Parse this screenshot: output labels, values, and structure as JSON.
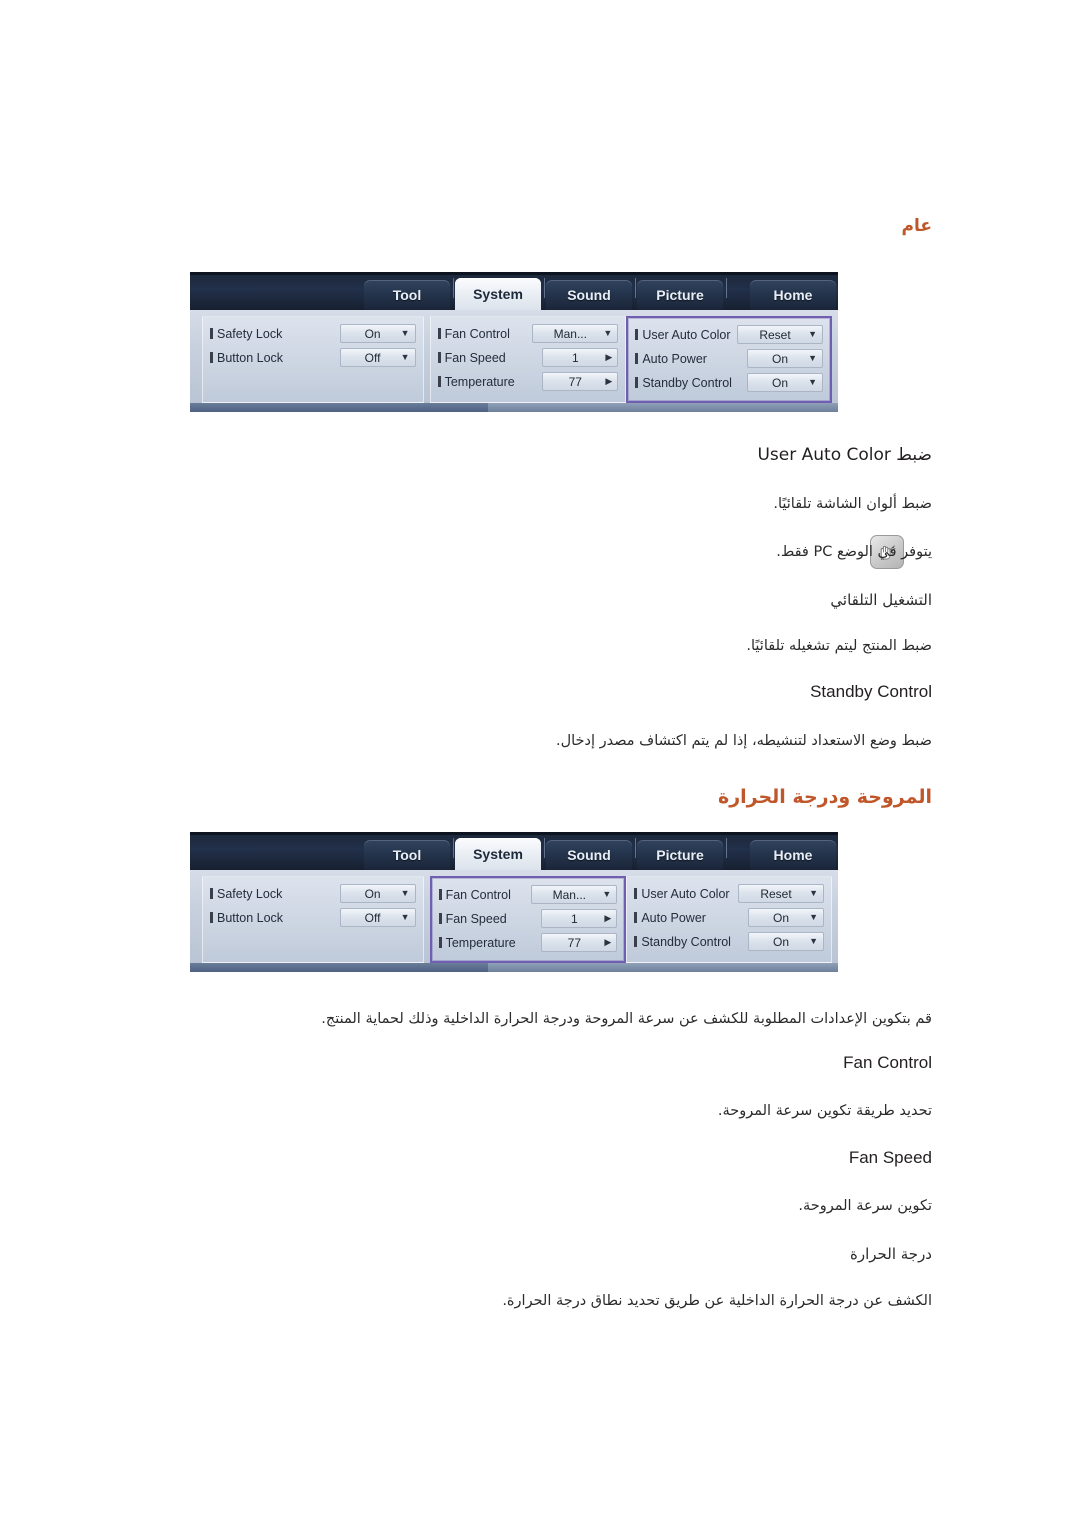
{
  "sections": {
    "general": {
      "heading": "عام",
      "subhead_user_auto_color": "ضبط User Auto Color",
      "desc_user_auto_color": "ضبط ألوان الشاشة تلقائيًا.",
      "note": "يتوفر في الوضع PC فقط.",
      "subhead_auto_power": "التشغيل التلقائي",
      "desc_auto_power": "ضبط المنتج ليتم تشغيله تلقائيًا.",
      "subhead_standby": "Standby Control",
      "desc_standby": "ضبط وضع الاستعداد لتنشيطه، إذا لم يتم اكتشاف مصدر إدخال.",
      "note_icon": "note-hand-icon"
    },
    "fan": {
      "heading": "المروحة ودرجة الحرارة",
      "intro": "قم بتكوين الإعدادات المطلوبة للكشف عن سرعة المروحة ودرجة الحرارة الداخلية وذلك لحماية المنتج.",
      "subhead_fan_control": "Fan Control",
      "desc_fan_control": "تحديد طريقة تكوين سرعة المروحة.",
      "subhead_fan_speed": "Fan Speed",
      "desc_fan_speed": "تكوين سرعة المروحة.",
      "subhead_temperature": "درجة الحرارة",
      "desc_temperature": "الكشف عن درجة الحرارة الداخلية عن طريق تحديد نطاق درجة الحرارة."
    }
  },
  "colors": {
    "heading_accent": "#c0572a",
    "highlight_border": "#6f5fb0",
    "osd_tabbar": "#1b2638",
    "body_text": "#231f20"
  },
  "osd": {
    "tabs": [
      {
        "label": "Home",
        "active": false
      },
      {
        "label": "Picture",
        "active": false
      },
      {
        "label": "Sound",
        "active": false
      },
      {
        "label": "System",
        "active": true
      },
      {
        "label": "Tool",
        "active": false
      }
    ],
    "columns": [
      {
        "name": "power-column",
        "rows": [
          {
            "label": "User Auto Color",
            "value": "Reset",
            "control": "dropdown",
            "arrow": "▼"
          },
          {
            "label": "Auto Power",
            "value": "On",
            "control": "dropdown",
            "arrow": "▼"
          },
          {
            "label": "Standby Control",
            "value": "On",
            "control": "dropdown",
            "arrow": "▼"
          }
        ]
      },
      {
        "name": "fan-column",
        "rows": [
          {
            "label": "Fan Control",
            "value": "Man...",
            "control": "dropdown",
            "arrow": "▼"
          },
          {
            "label": "Fan Speed",
            "value": "1",
            "control": "stepper",
            "arrow": "▶"
          },
          {
            "label": "Temperature",
            "value": "77",
            "control": "stepper",
            "arrow": "▶"
          }
        ]
      },
      {
        "name": "lock-column",
        "rows": [
          {
            "label": "Safety Lock",
            "value": "On",
            "control": "dropdown",
            "arrow": "▼"
          },
          {
            "label": "Button Lock",
            "value": "Off",
            "control": "dropdown",
            "arrow": "▼"
          }
        ]
      }
    ],
    "screenshot_one_highlight": "power-column",
    "screenshot_two_highlight": "fan-column"
  }
}
